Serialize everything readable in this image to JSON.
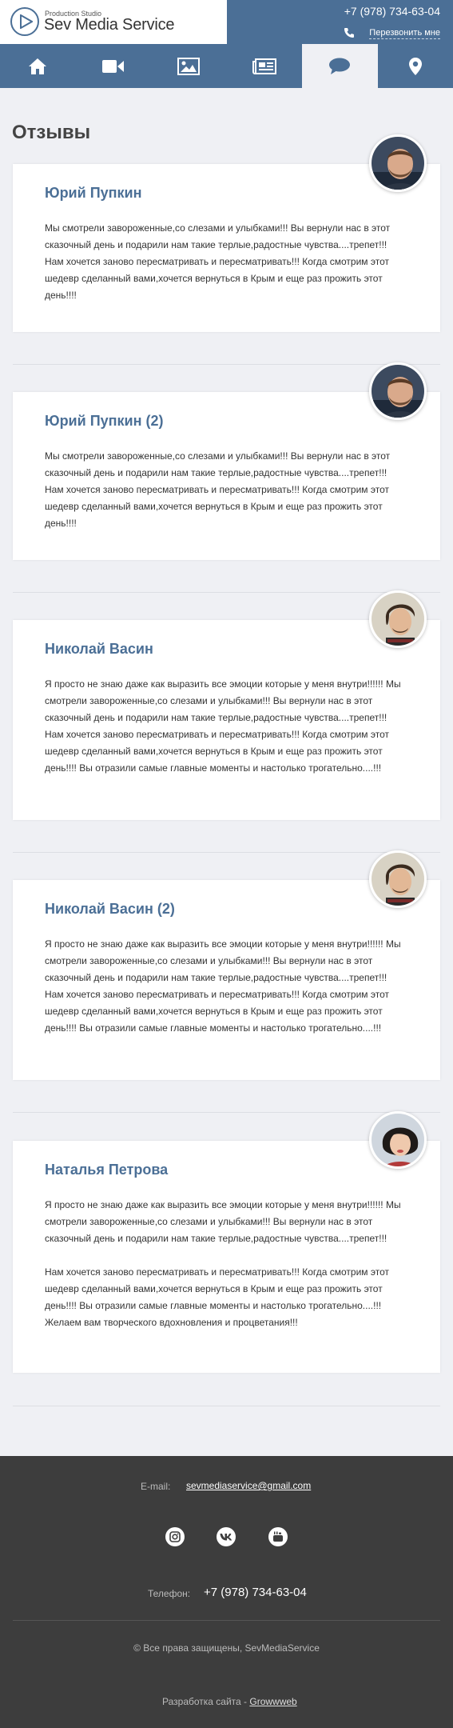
{
  "header": {
    "logo_small": "Production Studio",
    "logo_big": "Sev Media Service",
    "phone": "+7 (978) 734-63-04",
    "callback": "Перезвонить мне"
  },
  "nav": {
    "items": [
      "home-icon",
      "video-icon",
      "photo-icon",
      "news-icon",
      "reviews-icon",
      "location-icon"
    ],
    "active": "reviews-icon",
    "accent_color": "#4b6f96"
  },
  "page": {
    "title": "Отзывы"
  },
  "reviews": [
    {
      "name": "Юрий Пупкин",
      "paragraphs": [
        "Мы смотрели завороженные,со слезами и улыбками!!! Вы вернули нас в этот сказочный день и подарили нам такие терлые,радостные чувства....трепет!!! Нам хочется заново пересматривать и пересматривать!!! Когда смотрим этот шедевр сделанный вами,хочется вернуться в Крым и еще раз прожить этот день!!!!"
      ]
    },
    {
      "name": "Юрий Пупкин (2)",
      "paragraphs": [
        "Мы смотрели завороженные,со слезами и улыбками!!! Вы вернули нас в этот сказочный день и подарили нам такие терлые,радостные чувства....трепет!!! Нам хочется заново пересматривать и пересматривать!!! Когда смотрим этот шедевр сделанный вами,хочется вернуться в Крым и еще раз прожить этот день!!!!"
      ]
    },
    {
      "name": "Николай Васин",
      "paragraphs": [
        "Я просто не знаю даже как выразить все эмоции которые у меня внутри!!!!!! Мы смотрели завороженные,со слезами и улыбками!!! Вы вернули нас в этот сказочный день и подарили нам такие терлые,радостные чувства....трепет!!! Нам хочется заново пересматривать и пересматривать!!! Когда смотрим этот шедевр сделанный вами,хочется вернуться в Крым и еще раз прожить этот день!!!! Вы отразили самые главные моменты и настолько трогательно....!!!"
      ]
    },
    {
      "name": "Николай Васин (2)",
      "paragraphs": [
        "Я просто не знаю даже как выразить все эмоции которые у меня внутри!!!!!! Мы смотрели завороженные,со слезами и улыбками!!! Вы вернули нас в этот сказочный день и подарили нам такие терлые,радостные чувства....трепет!!! Нам хочется заново пересматривать и пересматривать!!! Когда смотрим этот шедевр сделанный вами,хочется вернуться в Крым и еще раз прожить этот день!!!! Вы отразили самые главные моменты и настолько трогательно....!!!"
      ]
    },
    {
      "name": "Наталья Петрова",
      "paragraphs": [
        "Я просто не знаю даже как выразить все эмоции которые у меня внутри!!!!!! Мы смотрели завороженные,со слезами и улыбками!!! Вы вернули нас в этот сказочный день и подарили нам такие терлые,радостные чувства....трепет!!!",
        "Нам хочется заново пересматривать и пересматривать!!! Когда смотрим этот шедевр сделанный вами,хочется вернуться в Крым и еще раз прожить этот день!!!! Вы отразили самые главные моменты и настолько трогательно....!!! Желаем вам творческого вдохновления и процветания!!!"
      ]
    }
  ],
  "footer": {
    "email_label": "E-mail:",
    "email": "sevmediaservice@gmail.com",
    "social": [
      "instagram-icon",
      "vk-icon",
      "youtube-icon"
    ],
    "phone_label": "Телефон:",
    "phone": "+7 (978) 734-63-04",
    "copyright": "© Все права защищены, SevMediaService",
    "dev_label": "Разработка сайта - ",
    "dev_link": "Growwweb"
  }
}
